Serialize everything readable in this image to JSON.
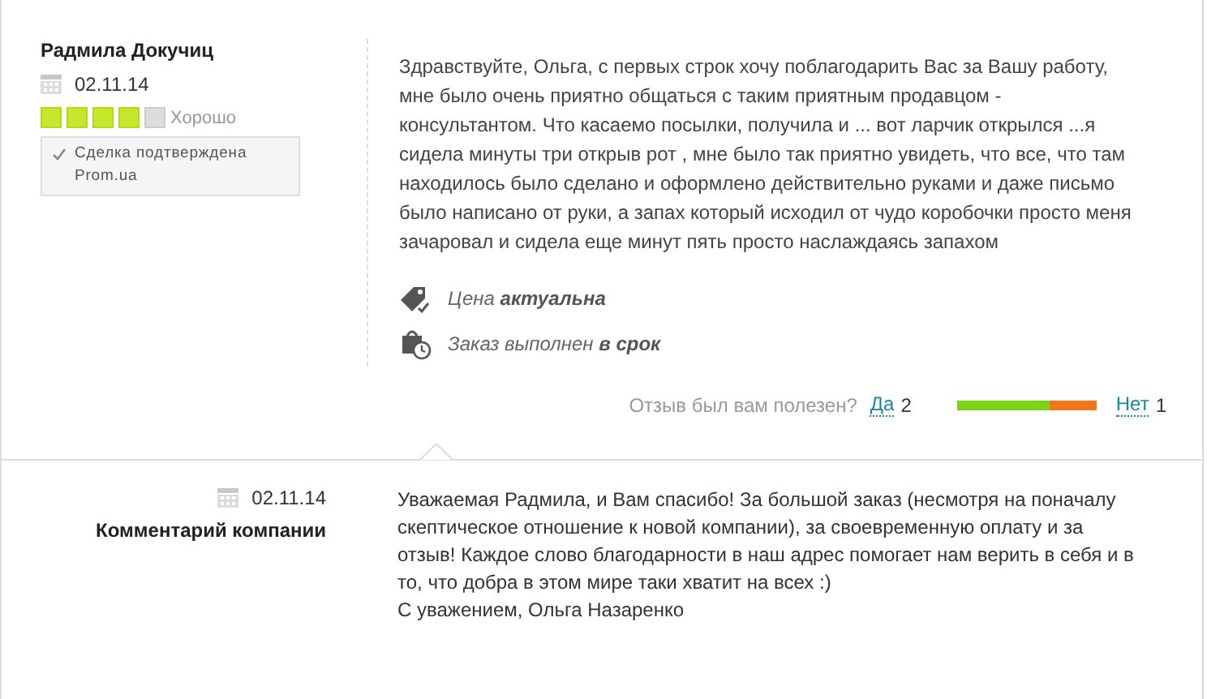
{
  "review": {
    "author": "Радмила Докучиц",
    "date": "02.11.14",
    "stars": 4,
    "rating_label": "Хорошо",
    "verified": "Сделка подтверждена Prom.ua",
    "text": "Здравствуйте, Ольга, с первых строк хочу поблагодарить Вас за Вашу работу, мне было очень приятно общаться с таким приятным продавцом - консультантом. Что касаемо посылки, получила и ... вот ларчик открылся ...я сидела минуты три открыв рот , мне было так приятно увидеть, что все, что там находилось было сделано и оформлено действительно руками и даже письмо было написано от руки, а запах который исходил от чудо коробочки просто меня зачаровал и сидела еще минут пять просто наслаждаясь запахом",
    "facts": [
      {
        "kind": "price",
        "text": "Цена **актуальна**"
      },
      {
        "kind": "deadline",
        "text": "Заказ выполнен **в срок**"
      }
    ],
    "helpful": {
      "question": "Отзыв был вам полезен?",
      "yes": "Да",
      "yes_count": "2",
      "level": 0.67,
      "no": "Нет",
      "no_count": "1"
    }
  },
  "reply": {
    "date": "02.11.14",
    "label": "Комментарий компании",
    "text": "Уважаемая Радмила, и Вам спасибо! За большой заказ (несмотря на поначалу скептическое отношение к новой компании), за своевременную оплату и за отзыв! Каждое слово благодарности в наш адрес помогает нам верить в себя и в то, что добра в этом мире таки хватит на всех :)\nС уважением, Ольга Назаренко"
  }
}
